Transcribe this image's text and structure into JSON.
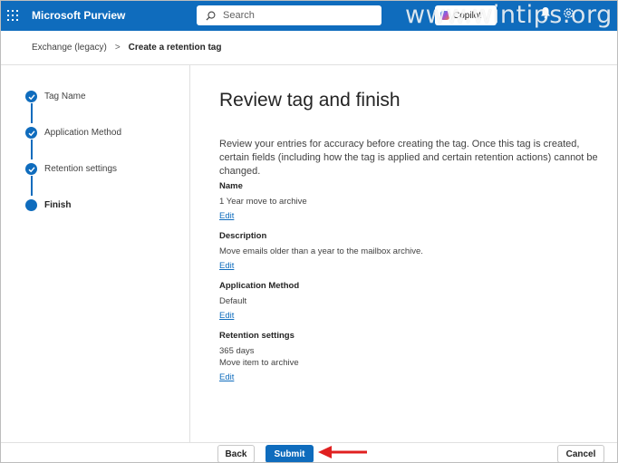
{
  "header": {
    "app_title": "Microsoft Purview",
    "search_placeholder": "Search",
    "copilot_label": "Copilot",
    "watermark": "www.wintips.org",
    "accent_color": "#0f6cbd"
  },
  "breadcrumb": {
    "parent": "Exchange (legacy)",
    "separator": ">",
    "current": "Create a retention tag"
  },
  "steps": [
    {
      "label": "Tag Name",
      "status": "completed"
    },
    {
      "label": "Application Method",
      "status": "completed"
    },
    {
      "label": "Retention settings",
      "status": "completed"
    },
    {
      "label": "Finish",
      "status": "current"
    }
  ],
  "main": {
    "title": "Review tag and finish",
    "intro": "Review your entries for accuracy before creating the tag. Once this tag is created, certain fields (including how the tag is applied and certain retention actions) cannot be changed.",
    "sections": [
      {
        "label": "Name",
        "values": [
          "1 Year move to archive"
        ],
        "edit": "Edit"
      },
      {
        "label": "Description",
        "values": [
          "Move emails older than a year to the mailbox archive."
        ],
        "edit": "Edit"
      },
      {
        "label": "Application Method",
        "values": [
          "Default"
        ],
        "edit": "Edit"
      },
      {
        "label": "Retention settings",
        "values": [
          "365 days",
          "Move item to archive"
        ],
        "edit": "Edit"
      }
    ]
  },
  "footer": {
    "back_label": "Back",
    "submit_label": "Submit",
    "cancel_label": "Cancel"
  },
  "icons": {
    "waffle": "app-launcher-icon",
    "search": "search-icon",
    "bell": "bell-icon",
    "gear": "gear-icon",
    "check": "checkmark-icon",
    "arrow": "red-arrow-icon"
  }
}
